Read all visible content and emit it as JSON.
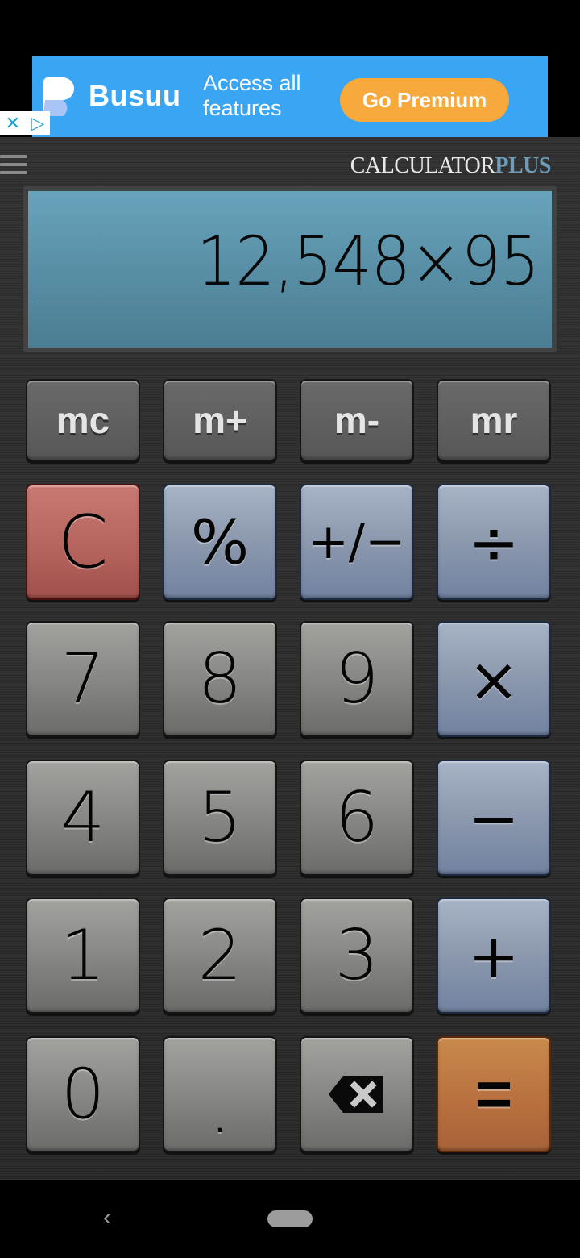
{
  "ad": {
    "brand": "Busuu",
    "tagline_line1": "Access all",
    "tagline_line2": "features",
    "cta": "Go Premium",
    "close_glyph": "✕",
    "adchoices_glyph": "▷",
    "colors": {
      "background": "#3aa6f3",
      "cta": "#f8a93c"
    }
  },
  "header": {
    "menu_icon": "hamburger-menu-icon",
    "brand_part1": "CALCULATOR",
    "brand_part2": "PLUS"
  },
  "display": {
    "expression": "12,548×95"
  },
  "keys": {
    "memory": [
      "mc",
      "m+",
      "m-",
      "mr"
    ],
    "row1": [
      "C",
      "%",
      "+/−",
      "÷"
    ],
    "row2": [
      "7",
      "8",
      "9",
      "×"
    ],
    "row3": [
      "4",
      "5",
      "6",
      "−"
    ],
    "row4": [
      "1",
      "2",
      "3",
      "+"
    ],
    "row5": [
      "0",
      ".",
      "backspace-icon",
      "="
    ]
  },
  "colors": {
    "clear_key": "#b3625c",
    "operator_key": "#8b98ad",
    "number_key": "#8a8a88",
    "equals_key": "#b76f3e",
    "display": "#5a91a8"
  },
  "navbar": {
    "back_glyph": "‹"
  }
}
